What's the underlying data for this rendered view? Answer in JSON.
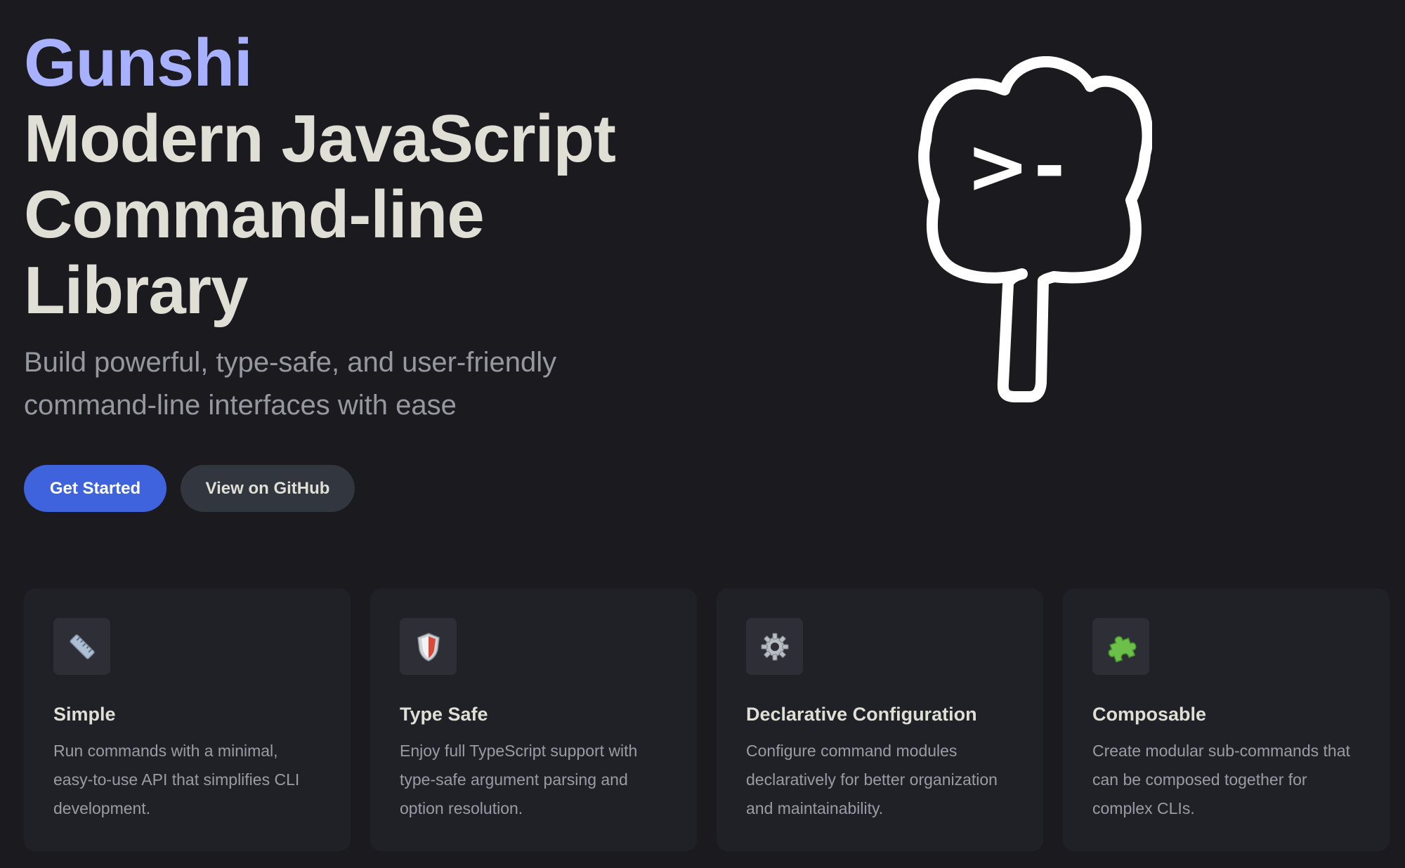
{
  "hero": {
    "name": "Gunshi",
    "text_lines": [
      "Modern JavaScript",
      "Command-line",
      "Library"
    ],
    "tagline": "Build powerful, type-safe, and user-friendly command-line interfaces with ease",
    "logo_text": ">-"
  },
  "actions": {
    "get_started": "Get Started",
    "github": "View on GitHub"
  },
  "features": [
    {
      "icon": "ruler-icon",
      "title": "Simple",
      "details": "Run commands with a minimal, easy-to-use API that simplifies CLI development."
    },
    {
      "icon": "shield-icon",
      "title": "Type Safe",
      "details": "Enjoy full TypeScript support with type-safe argument parsing and option resolution."
    },
    {
      "icon": "gear-icon",
      "title": "Declarative Configuration",
      "details": "Configure command modules declaratively for better organization and maintainability."
    },
    {
      "icon": "puzzle-icon",
      "title": "Composable",
      "details": "Create modular sub-commands that can be composed together for complex CLIs."
    }
  ],
  "colors": {
    "background": "#1b1b1f",
    "brand_name": "#a8b1ff",
    "brand_button": "#3e63dd",
    "alt_button": "#32363f",
    "card": "#202127"
  }
}
